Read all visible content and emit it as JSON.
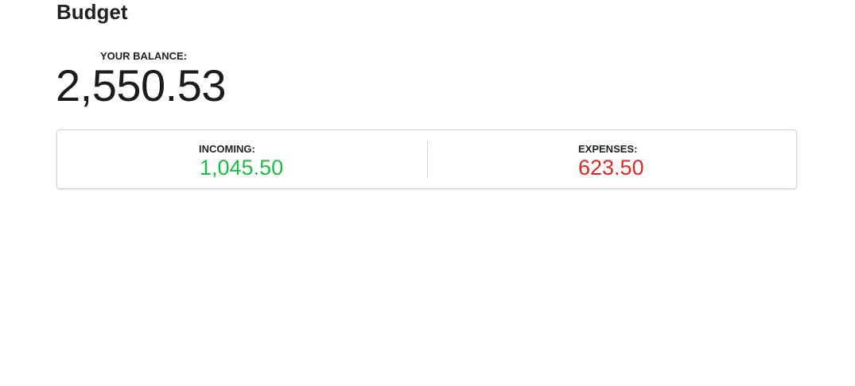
{
  "header": {
    "title": "Budget"
  },
  "balance": {
    "label": "YOUR BALANCE:",
    "value": "2,550.53"
  },
  "stats": {
    "incoming": {
      "label": "INCOMING:",
      "value": "1,045.50",
      "color": "#21ba45"
    },
    "expenses": {
      "label": "EXPENSES:",
      "value": "623.50",
      "color": "#db2828"
    }
  }
}
